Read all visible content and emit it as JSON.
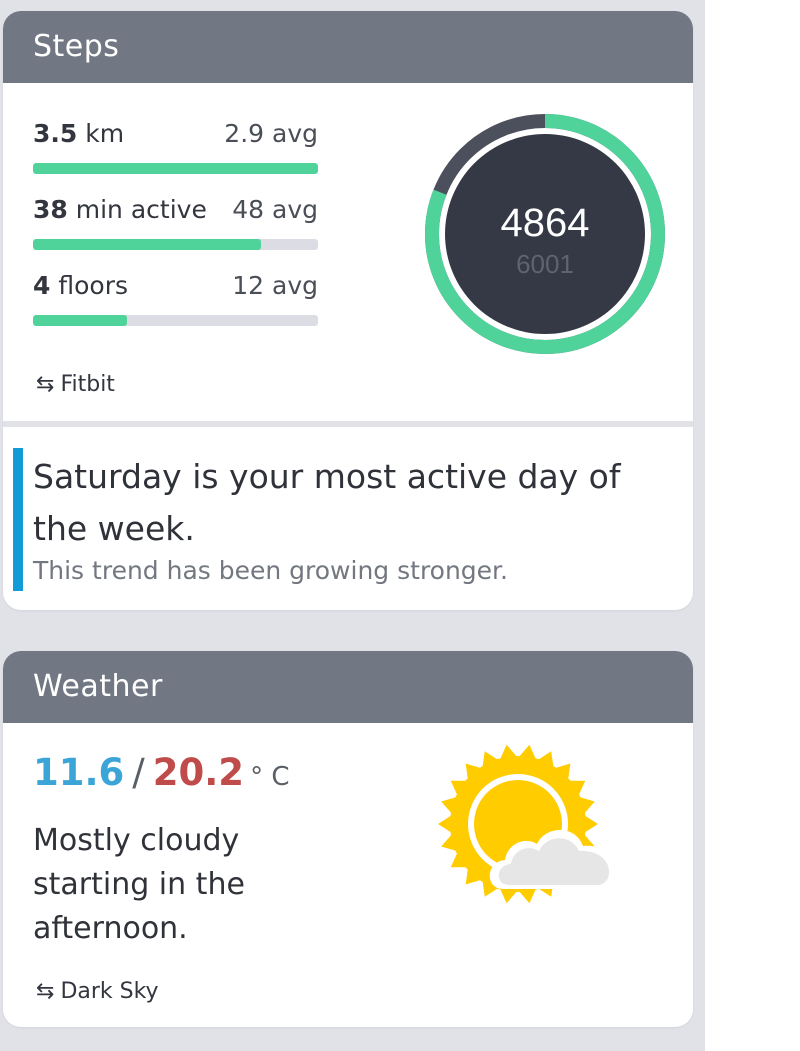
{
  "steps": {
    "title": "Steps",
    "metrics": [
      {
        "value": "3.5",
        "unit": "km",
        "avg": "2.9 avg",
        "fraction": 1.0
      },
      {
        "value": "38",
        "unit": "min active",
        "avg": "48 avg",
        "fraction": 0.8
      },
      {
        "value": "4",
        "unit": "floors",
        "avg": "12 avg",
        "fraction": 0.33
      }
    ],
    "source": "Fitbit",
    "source_icon": "swap-arrows-icon",
    "count": "4864",
    "goal": "6001",
    "progress_fraction": 0.81,
    "colors": {
      "accent": "#4fd39a",
      "ring_dark": "#343945",
      "ring_track": "#4b505c"
    }
  },
  "insight": {
    "title": "Saturday is your most active day of the week.",
    "subtitle": "This trend has been growing stronger.",
    "accent": "#139bd8"
  },
  "weather": {
    "title": "Weather",
    "low": "11.6",
    "separator": "/",
    "high": "20.2",
    "unit": "° C",
    "summary": "Mostly cloudy starting in the afternoon.",
    "icon": "sun-cloud-icon",
    "source": "Dark Sky",
    "colors": {
      "low": "#3ca5d8",
      "high": "#c04b4b",
      "sun": "#ffcc00"
    }
  }
}
